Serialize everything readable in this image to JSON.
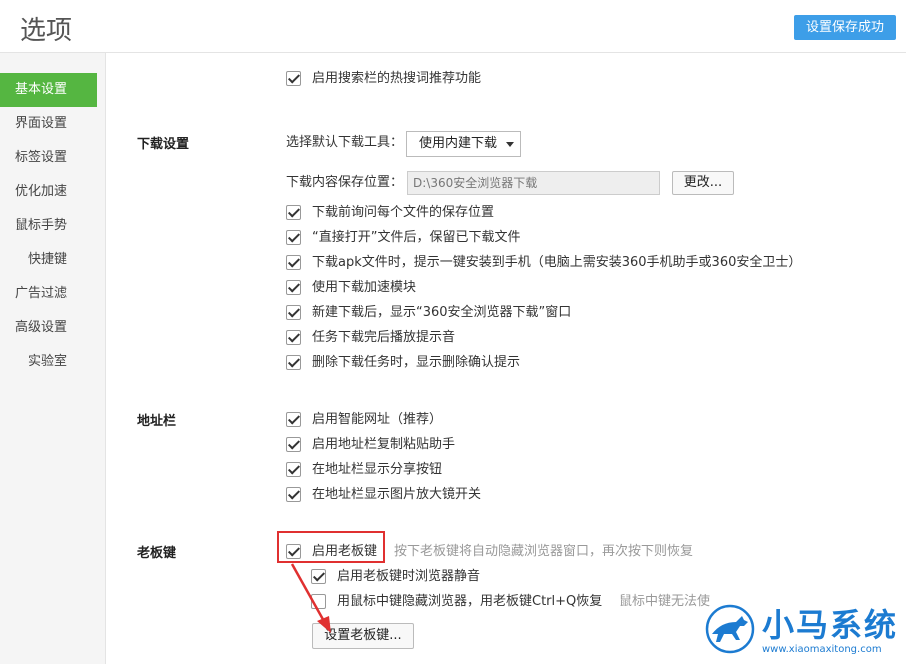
{
  "header": {
    "title": "选项",
    "save_status": "设置保存成功"
  },
  "sidebar": {
    "items": [
      {
        "label": "基本设置",
        "active": true
      },
      {
        "label": "界面设置"
      },
      {
        "label": "标签设置"
      },
      {
        "label": "优化加速"
      },
      {
        "label": "鼠标手势"
      },
      {
        "label": "快捷键"
      },
      {
        "label": "广告过滤"
      },
      {
        "label": "高级设置"
      },
      {
        "label": "实验室"
      }
    ]
  },
  "search": {
    "hot_words": "启用搜索栏的热搜词推荐功能"
  },
  "download": {
    "title": "下载设置",
    "tool_label": "选择默认下载工具：",
    "tool_value": "使用内建下载",
    "path_label": "下载内容保存位置：",
    "path_value": "D:\\360安全浏览器下载",
    "change_button": "更改...",
    "options": [
      "下载前询问每个文件的保存位置",
      "“直接打开”文件后，保留已下载文件",
      "下载apk文件时，提示一键安装到手机（电脑上需安装360手机助手或360安全卫士）",
      "使用下载加速模块",
      "新建下载后，显示“360安全浏览器下载”窗口",
      "任务下载完后播放提示音",
      "删除下载任务时，显示删除确认提示"
    ]
  },
  "addressbar": {
    "title": "地址栏",
    "options": [
      "启用智能网址（推荐）",
      "启用地址栏复制粘贴助手",
      "在地址栏显示分享按钮",
      "在地址栏显示图片放大镜开关"
    ]
  },
  "bosskey": {
    "title": "老板键",
    "enable_label": "启用老板键",
    "enable_hint": "按下老板键将自动隐藏浏览器窗口，再次按下则恢复",
    "mute_label": "启用老板键时浏览器静音",
    "middle_label": "用鼠标中键隐藏浏览器，用老板键Ctrl+Q恢复",
    "middle_hint": "鼠标中键无法使",
    "settings_button": "设置老板键..."
  },
  "watermark": {
    "brand": "小马系统",
    "url": "www.xiaomaxitong.com"
  },
  "colors": {
    "accent_green": "#55b641",
    "badge_blue": "#3d9ee8",
    "highlight_red": "#e03030",
    "watermark_blue": "#1c7bd1"
  }
}
